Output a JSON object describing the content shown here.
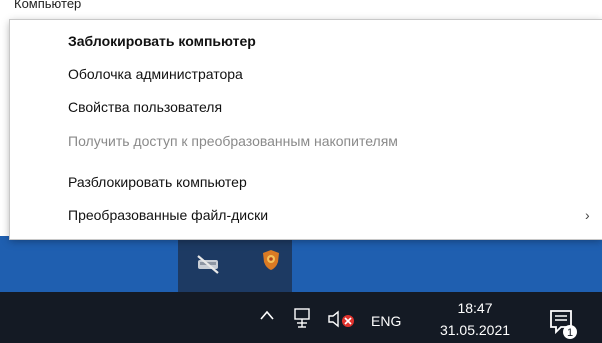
{
  "window_title": "Компьютер",
  "context_menu": {
    "items": [
      {
        "label": "Заблокировать компьютер",
        "bold": true,
        "disabled": false,
        "submenu": false
      },
      {
        "label": "Оболочка администратора",
        "bold": false,
        "disabled": false,
        "submenu": false
      },
      {
        "label": "Свойства пользователя",
        "bold": false,
        "disabled": false,
        "submenu": false
      },
      {
        "label": "Получить доступ к преобразованным накопителям",
        "bold": false,
        "disabled": true,
        "submenu": false
      },
      {
        "label": "Разблокировать компьютер",
        "bold": false,
        "disabled": false,
        "submenu": false
      },
      {
        "label": "Преобразованные файл-диски",
        "bold": false,
        "disabled": false,
        "submenu": true
      }
    ],
    "submenu_arrow": "›"
  },
  "tray_overflow": {
    "icons": [
      "hidden-drive-icon",
      "shield-app-icon"
    ]
  },
  "taskbar": {
    "icons": [
      "chevron-up-icon",
      "network-icon",
      "volume-muted-icon",
      "notification-icon"
    ],
    "language": "ENG",
    "time": "18:47",
    "date": "31.05.2021",
    "notification_count": "1",
    "colors": {
      "taskbar": "#141a24",
      "desktop": "#1f5fb0",
      "overflow": "#1d3a63",
      "mute": "#e0322d"
    }
  }
}
